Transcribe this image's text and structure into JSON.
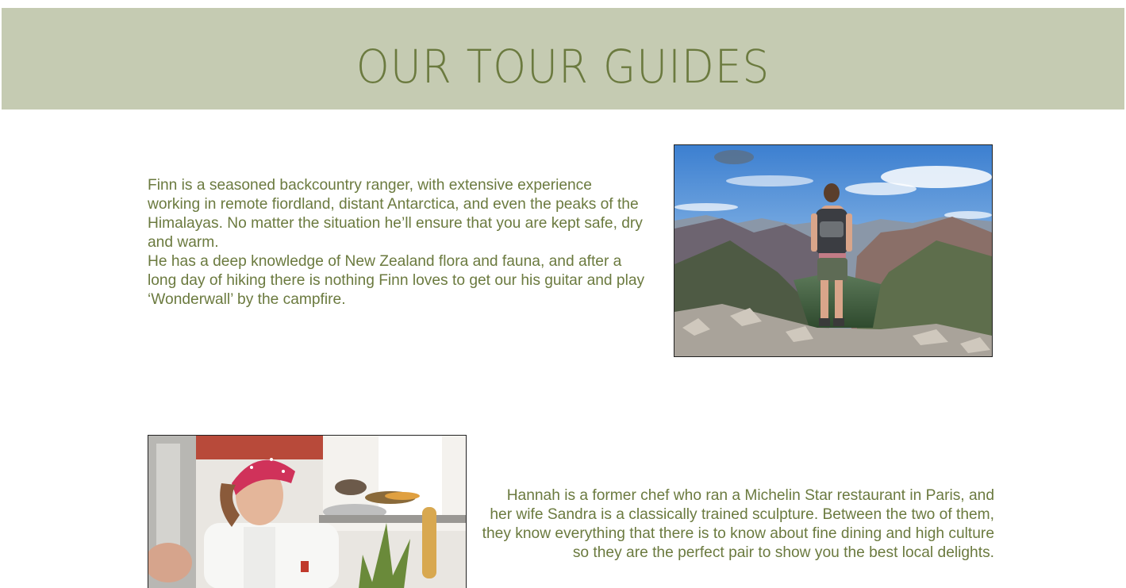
{
  "header": {
    "title": "OUR TOUR GUIDES",
    "background_color": "#c5cbb2",
    "text_color": "#6b7a3f"
  },
  "guides": [
    {
      "name": "Finn",
      "paragraphs": [
        "Finn is a seasoned backcountry ranger, with extensive experience working in remote fiordland, distant Antarctica, and even the peaks of the Himalayas. No matter the situation he’ll ensure that you are kept safe, dry and warm.",
        "He has a deep knowledge of New Zealand flora and fauna, and after a long day of hiking there is nothing Finn loves to get our his guitar and play ‘Wonderwall’ by the campfire."
      ],
      "photo": "hiker-mountain-photo"
    },
    {
      "name": "Hannah",
      "paragraphs": [
        "Hannah is a former chef who ran a Michelin Star restaurant in Paris, and her wife Sandra is a classically trained sculpture. Between the two of them, they know everything that there is to know about fine dining and high culture so they are the perfect pair to show you the best local delights."
      ],
      "photo": "chef-kitchen-photo"
    }
  ]
}
